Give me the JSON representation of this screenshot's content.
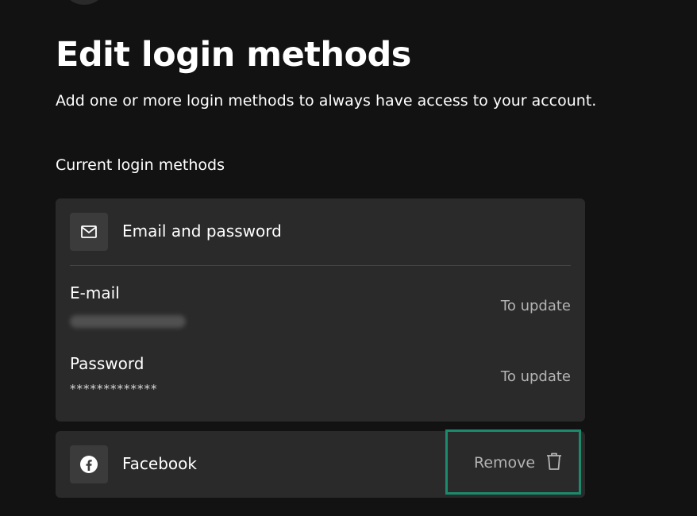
{
  "header": {
    "title": "Edit login methods",
    "subtitle": "Add one or more login methods to always have access to your account."
  },
  "section": {
    "label": "Current login methods"
  },
  "email_method": {
    "icon": "mail-icon",
    "title": "Email and password",
    "email_label": "E-mail",
    "email_update": "To update",
    "password_label": "Password",
    "password_value": "*************",
    "password_update": "To update"
  },
  "facebook_method": {
    "icon": "facebook-icon",
    "title": "Facebook",
    "remove_label": "Remove",
    "remove_icon": "trash-icon"
  },
  "colors": {
    "background": "#121212",
    "card": "#2a2a2a",
    "icon_box": "#3b3b3b",
    "muted_text": "#b3b3b3",
    "highlight": "#1a8b6c"
  }
}
